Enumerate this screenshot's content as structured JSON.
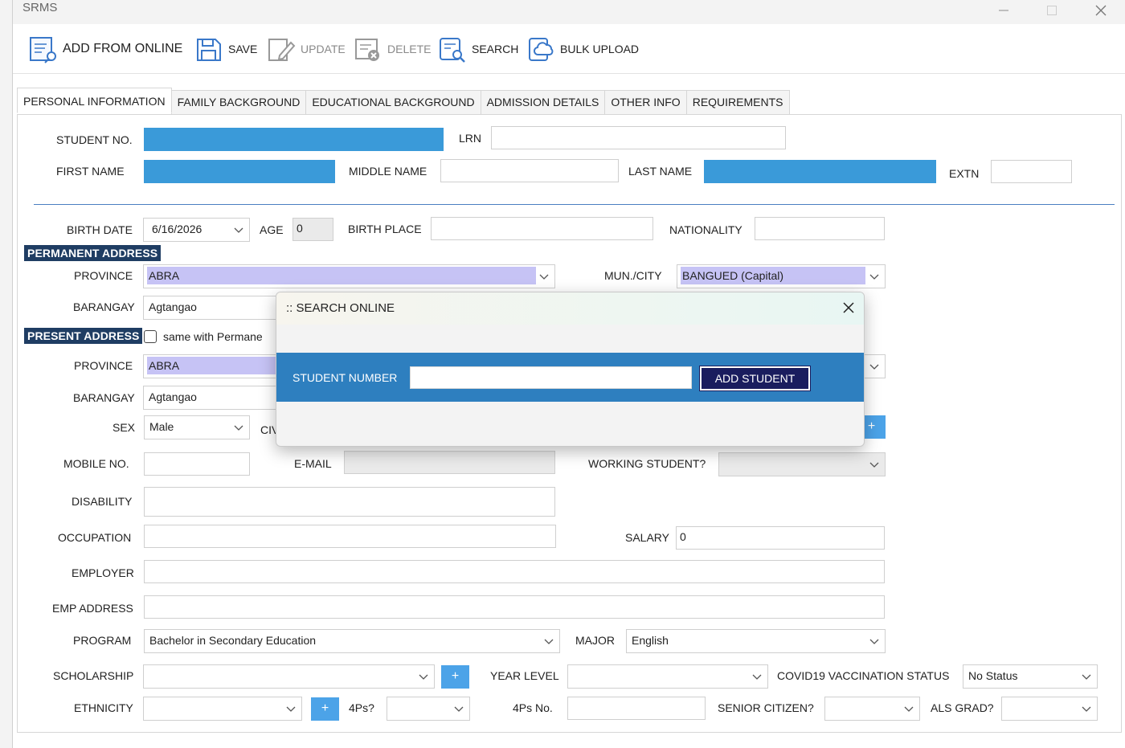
{
  "window": {
    "title": "SRMS"
  },
  "toolbar": {
    "add_online": "ADD FROM ONLINE",
    "save": "SAVE",
    "update": "UPDATE",
    "delete": "DELETE",
    "search": "SEARCH",
    "bulk_upload": "BULK UPLOAD"
  },
  "tabs": [
    "PERSONAL INFORMATION",
    "FAMILY BACKGROUND",
    "EDUCATIONAL BACKGROUND",
    "ADMISSION DETAILS",
    "OTHER INFO",
    "REQUIREMENTS"
  ],
  "form": {
    "student_no_label": "STUDENT NO.",
    "lrn_label": "LRN",
    "first_name_label": "FIRST NAME",
    "middle_name_label": "MIDDLE NAME",
    "last_name_label": "LAST NAME",
    "extn_label": "EXTN",
    "birth_date_label": "BIRTH DATE",
    "birth_date": "6/16/2026",
    "age_label": "AGE",
    "age": "0",
    "birth_place_label": "BIRTH PLACE",
    "nationality_label": "NATIONALITY",
    "permanent_address": "PERMANENT ADDRESS",
    "province_label": "PROVINCE",
    "perm_province": "ABRA",
    "mun_city_label": "MUN./CITY",
    "perm_city": "BANGUED (Capital)",
    "barangay_label": "BARANGAY",
    "perm_barangay": "Agtangao",
    "present_address": "PRESENT ADDRESS",
    "same_with": "same with Permane",
    "pres_province": "ABRA",
    "pres_barangay": "Agtangao",
    "sex_label": "SEX",
    "sex": "Male",
    "civil_label": "CIV",
    "mobile_label": "MOBILE NO.",
    "email_label": "E-MAIL",
    "working_label": "WORKING STUDENT?",
    "disability_label": "DISABILITY",
    "occupation_label": "OCCUPATION",
    "salary_label": "SALARY",
    "salary": "0",
    "employer_label": "EMPLOYER",
    "emp_address_label": "EMP ADDRESS",
    "program_label": "PROGRAM",
    "program": "Bachelor in Secondary Education",
    "major_label": "MAJOR",
    "major": "English",
    "scholarship_label": "SCHOLARSHIP",
    "year_level_label": "YEAR LEVEL",
    "covid_label": "COVID19 VACCINATION STATUS",
    "covid": "No Status",
    "ethnicity_label": "ETHNICITY",
    "fourps_label": "4Ps?",
    "fourps_no_label": "4Ps No.",
    "senior_label": "SENIOR CITIZEN?",
    "als_label": "ALS GRAD?",
    "plus": "+"
  },
  "dialog": {
    "title": ":: SEARCH ONLINE",
    "student_number_label": "STUDENT NUMBER",
    "add_student": "ADD STUDENT"
  }
}
